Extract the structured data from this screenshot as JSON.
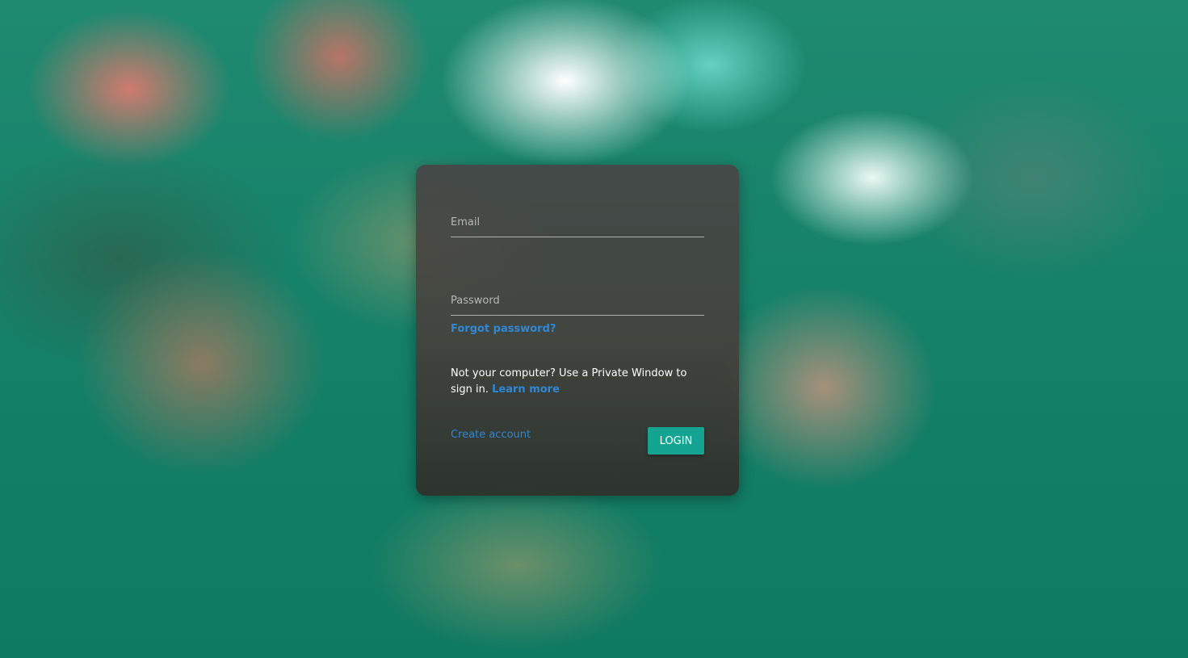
{
  "login_form": {
    "email_placeholder": "Email",
    "password_placeholder": "Password",
    "forgot_password": "Forgot password?",
    "notice_text": "Not your computer? Use a Private Window to sign in.",
    "learn_more": "Learn more",
    "create_account": "Create account",
    "login_button": "LOGIN"
  },
  "colors": {
    "link": "#2f87d6",
    "button": "#14a491",
    "card": "#474747",
    "background": "#137f67"
  }
}
